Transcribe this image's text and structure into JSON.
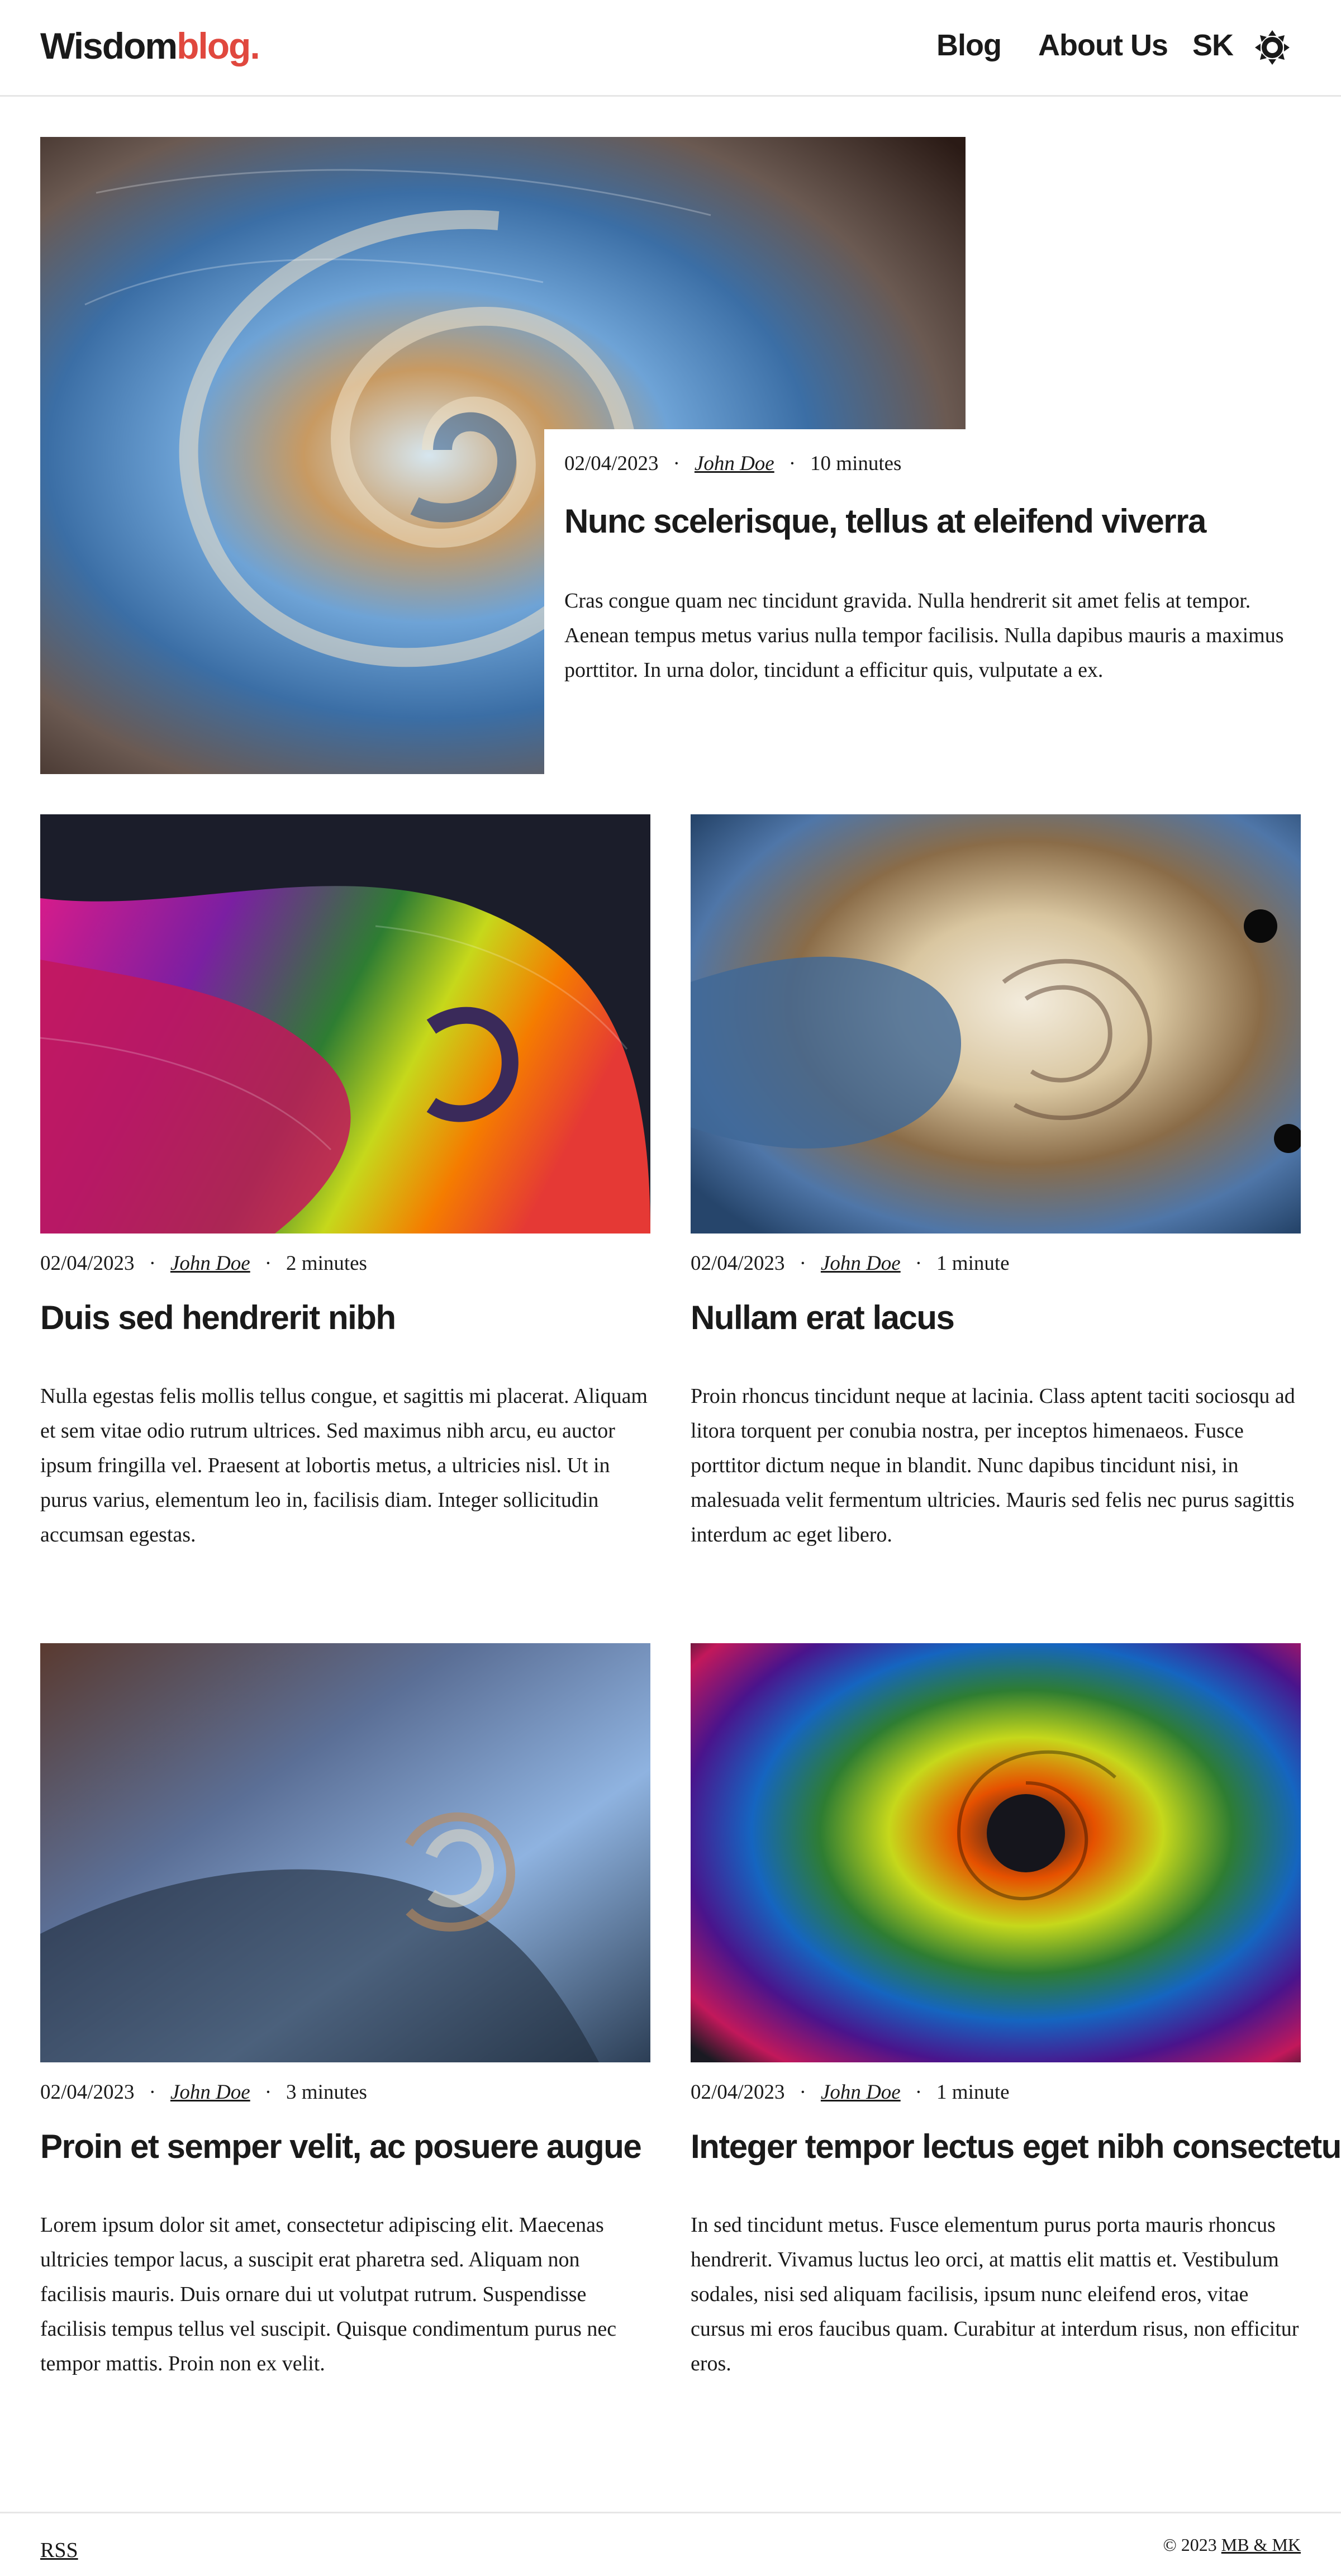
{
  "header": {
    "logo_part1": "Wisdom",
    "logo_part2": "blog",
    "logo_dot": ".",
    "nav": {
      "blog": "Blog",
      "about": "About Us",
      "lang": "SK"
    },
    "theme_icon": "sun-icon"
  },
  "featured": {
    "image_icon": "fractal-spiral-blue-bronze-image",
    "date": "02/04/2023",
    "author": "John Doe",
    "reading_time": "10 minutes",
    "title": "Nunc scelerisque, tellus at eleifend viverra",
    "excerpt": "Cras congue quam nec tincidunt gravida. Nulla hendrerit sit amet felis at tempor. Aenean tempus metus varius nulla tempor facilisis. Nulla dapibus mauris a maximus porttitor. In urna dolor, tincidunt a efficitur quis, vulputate a ex."
  },
  "posts": [
    {
      "image_icon": "fractal-spiral-rainbow-image",
      "date": "02/04/2023",
      "author": "John Doe",
      "reading_time": "2 minutes",
      "title": "Duis sed hendrerit nibh",
      "excerpt": "Nulla egestas felis mollis tellus congue, et sagittis mi placerat. Aliquam et sem vitae odio rutrum ultrices. Sed maximus nibh arcu, eu auctor ipsum fringilla vel. Praesent at lobortis metus, a ultricies nisl. Ut in purus varius, elementum leo in, facilisis diam. Integer sollicitudin accumsan egestas."
    },
    {
      "image_icon": "fractal-spiral-cream-blue-image",
      "date": "02/04/2023",
      "author": "John Doe",
      "reading_time": "1 minute",
      "title": "Nullam erat lacus",
      "excerpt": "Proin rhoncus tincidunt neque at lacinia. Class aptent taciti sociosqu ad litora torquent per conubia nostra, per inceptos himenaeos. Fusce porttitor dictum neque in blandit. Nunc dapibus tincidunt nisi, in malesuada velit fermentum ultricies. Mauris sed felis nec purus sagittis interdum ac eget libero."
    },
    {
      "image_icon": "fractal-spiral-brown-blue-image",
      "date": "02/04/2023",
      "author": "John Doe",
      "reading_time": "3 minutes",
      "title": "Proin et semper velit, ac posuere augue",
      "excerpt": "Lorem ipsum dolor sit amet, consectetur adipiscing elit. Maecenas ultricies tempor lacus, a suscipit erat pharetra sed. Aliquam non facilisis mauris. Duis ornare dui ut volutpat rutrum. Suspendisse facilisis tempus tellus vel suscipit. Quisque condimentum purus nec tempor mattis. Proin non ex velit."
    },
    {
      "image_icon": "fractal-spiral-neon-rainbow-image",
      "date": "02/04/2023",
      "author": "John Doe",
      "reading_time": "1 minute",
      "title": "Integer tempor lectus eget nibh consectetur",
      "excerpt": "In sed tincidunt metus. Fusce elementum purus porta mauris rhoncus hendrerit. Vivamus luctus leo orci, at mattis elit mattis et. Vestibulum sodales, nisi sed aliquam facilisis, ipsum nunc eleifend eros, vitae cursus mi eros faucibus quam. Curabitur at interdum risus, non efficitur eros."
    }
  ],
  "footer": {
    "rss": "RSS",
    "copyright": "© 2023",
    "owners": "MB & MK"
  },
  "colors": {
    "text": "#1a1a1a",
    "accent": "#e0483e",
    "border": "#e6e6e6",
    "background": "#ffffff"
  }
}
